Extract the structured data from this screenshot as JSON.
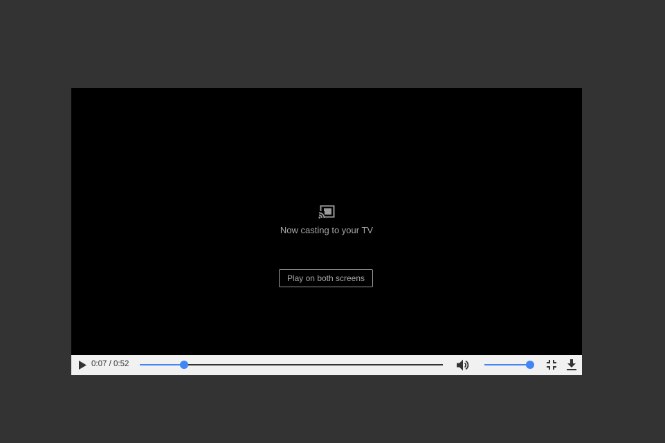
{
  "player": {
    "cast_message": "Now casting to your TV",
    "play_both_label": "Play on both screens"
  },
  "controls": {
    "current_time": "0:07",
    "separator": " / ",
    "duration": "0:52",
    "progress_fraction": 0.146,
    "volume_fraction": 1.0,
    "icons": [
      "play-icon",
      "volume-icon",
      "exit-fullscreen-icon",
      "download-icon"
    ]
  },
  "colors": {
    "page_background": "#333333",
    "video_background": "#000000",
    "control_bar": "#f1f1f1",
    "accent": "#4285f4",
    "cast_text": "#a8a8a8"
  }
}
